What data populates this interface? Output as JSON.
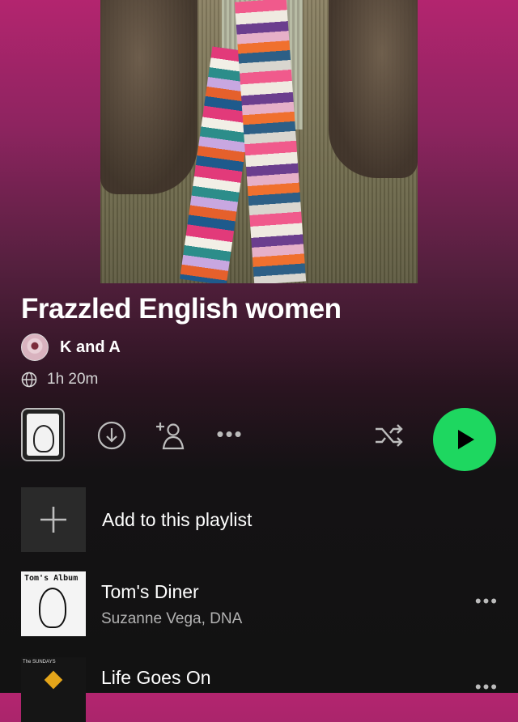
{
  "playlist": {
    "title": "Frazzled English women",
    "owner": "K and A",
    "duration": "1h 20m"
  },
  "controls": {
    "more_label": "•••"
  },
  "add_row": {
    "label": "Add to this playlist"
  },
  "tracks": [
    {
      "name": "Tom's Diner",
      "artist": "Suzanne Vega, DNA",
      "art_text": "Tom's Album",
      "more": "•••"
    },
    {
      "name": "Life Goes On",
      "artist": "",
      "art_text": "The SUNDAYS",
      "more": "•••"
    }
  ],
  "colors": {
    "accent_green": "#1ed760",
    "header_gradient_top": "#b3256f",
    "background": "#121212",
    "secondary_text": "#b3b3b3"
  },
  "icons": [
    "globe-icon",
    "download-icon",
    "add-user-icon",
    "more-icon",
    "shuffle-icon",
    "play-icon",
    "plus-icon"
  ]
}
